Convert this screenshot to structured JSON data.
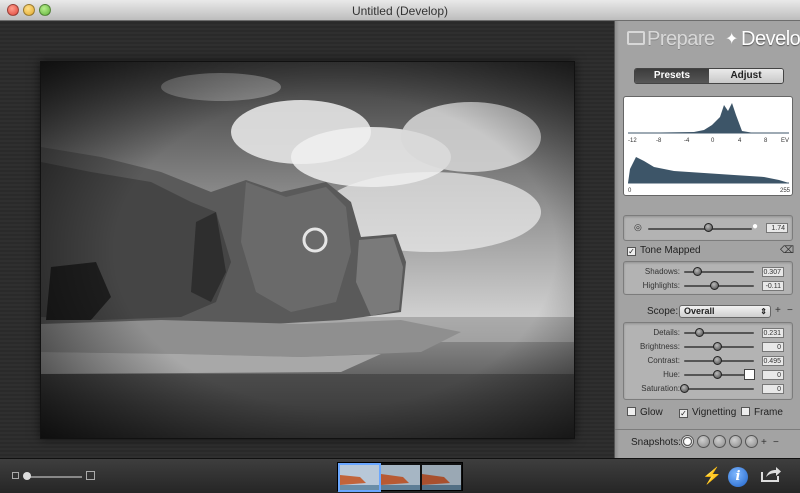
{
  "window": {
    "title": "Untitled (Develop)"
  },
  "brand": {
    "prepare": "Prepare",
    "develop": "Develop"
  },
  "tabs": {
    "presets": "Presets",
    "adjust": "Adjust"
  },
  "histogram": {
    "ev_ticks": [
      "-12",
      "-8",
      "-4",
      "0",
      "4",
      "8",
      "EV"
    ],
    "lin_ticks": [
      "0",
      "255"
    ],
    "fill_color": "#3d5568"
  },
  "exposure": {
    "value": "1.74"
  },
  "tone_mapped": {
    "label": "Tone Mapped",
    "checked": true
  },
  "tone": [
    {
      "label": "Shadows:",
      "value": "0.307",
      "level": 0.2
    },
    {
      "label": "Highlights:",
      "value": "-0.11",
      "level": 0.45
    }
  ],
  "scope": {
    "label": "Scope:",
    "selected": "Overall"
  },
  "adjust": [
    {
      "label": "Details:",
      "value": "0.231",
      "level": 0.22
    },
    {
      "label": "Brightness:",
      "value": "0",
      "level": 0.5
    },
    {
      "label": "Contrast:",
      "value": "0.495",
      "level": 0.5
    },
    {
      "label": "Hue:",
      "value": "0",
      "level": 0.5
    },
    {
      "label": "Saturation:",
      "value": "0",
      "level": 0.0
    }
  ],
  "effects": [
    {
      "label": "Glow",
      "checked": false
    },
    {
      "label": "Vignetting",
      "checked": true
    },
    {
      "label": "Frame",
      "checked": false
    }
  ],
  "snapshots": {
    "label": "Snapshots:",
    "count": 5,
    "active_index": 0
  },
  "icons": {
    "add": "+",
    "remove": "−",
    "lightning": "⚡",
    "share": "share-icon"
  },
  "info": {
    "glyph": "i"
  }
}
